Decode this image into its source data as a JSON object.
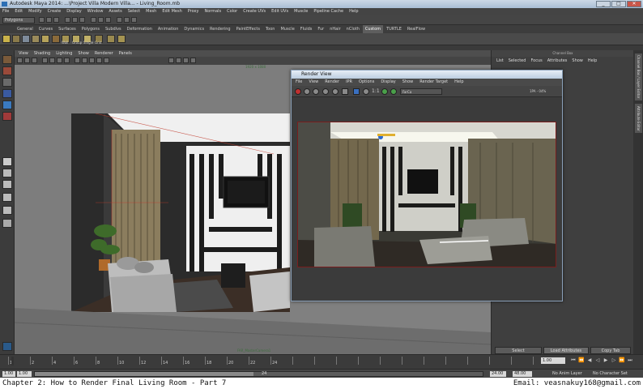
{
  "window": {
    "title": "Autodesk Maya 2014: ...\\Project Villa Modern Villa... - Living_Room.mb",
    "controls": [
      "_",
      "□",
      "✕"
    ]
  },
  "menubar": [
    "File",
    "Edit",
    "Modify",
    "Create",
    "Display",
    "Window",
    "Assets",
    "Select",
    "Mesh",
    "Edit Mesh",
    "Proxy",
    "Normals",
    "Color",
    "Create UVs",
    "Edit UVs",
    "Muscle",
    "Pipeline Cache",
    "Help"
  ],
  "status_line": {
    "mode": "Polygons"
  },
  "shelf_tabs": [
    {
      "label": "General",
      "active": false
    },
    {
      "label": "Curves",
      "active": false
    },
    {
      "label": "Surfaces",
      "active": false
    },
    {
      "label": "Polygons",
      "active": false
    },
    {
      "label": "Subdivs",
      "active": false
    },
    {
      "label": "Deformation",
      "active": false
    },
    {
      "label": "Animation",
      "active": false
    },
    {
      "label": "Dynamics",
      "active": false
    },
    {
      "label": "Rendering",
      "active": false
    },
    {
      "label": "PaintEffects",
      "active": false
    },
    {
      "label": "Toon",
      "active": false
    },
    {
      "label": "Muscle",
      "active": false
    },
    {
      "label": "Fluids",
      "active": false
    },
    {
      "label": "Fur",
      "active": false
    },
    {
      "label": "nHair",
      "active": false
    },
    {
      "label": "nCloth",
      "active": false
    },
    {
      "label": "Custom",
      "active": true
    },
    {
      "label": "TURTLE",
      "active": false
    },
    {
      "label": "RealFlow",
      "active": false
    }
  ],
  "shelf_icons": [
    "Wall",
    "Group",
    "Single",
    "Grid"
  ],
  "viewport": {
    "menu": [
      "View",
      "Shading",
      "Lighting",
      "Show",
      "Renderer",
      "Panels"
    ],
    "label_top": "1920 x 1080",
    "label_bottom": "FAR_MasterCamera1"
  },
  "channel_box": {
    "header": "Channel Box",
    "menu": [
      "List",
      "Selected",
      "Focus",
      "Attributes",
      "Show",
      "Help"
    ],
    "buttons": {
      "select": "Select",
      "load": "Load Attributes",
      "copy": "Copy Tab"
    }
  },
  "side_tabs": [
    "Channel Box / Layer Editor",
    "Attribute Editor"
  ],
  "render_view": {
    "title": "Render View",
    "menu": [
      "File",
      "View",
      "Render",
      "IPR",
      "Options",
      "Display",
      "Show",
      "Render Target",
      "Help"
    ],
    "size_label": "1:1",
    "camera": "FarCa",
    "zoom": "1PA - 04%"
  },
  "time_slider": {
    "ticks": [
      "1",
      "2",
      "4",
      "6",
      "8",
      "10",
      "12",
      "14",
      "16",
      "18",
      "20",
      "22",
      "24"
    ],
    "current_frame": "1.00",
    "marker_frame": "24"
  },
  "range": {
    "start": "1.00",
    "start2": "1.00",
    "end": "24.00",
    "end2": "48.00",
    "anim_layer": "No Anim Layer",
    "char_set": "No Character Set",
    "range_mark": "24"
  },
  "caption": {
    "left": "Chapter 2: How to Render Final Living Room - Part 7",
    "right": "Email: veasnakuy168@gmail.com"
  }
}
